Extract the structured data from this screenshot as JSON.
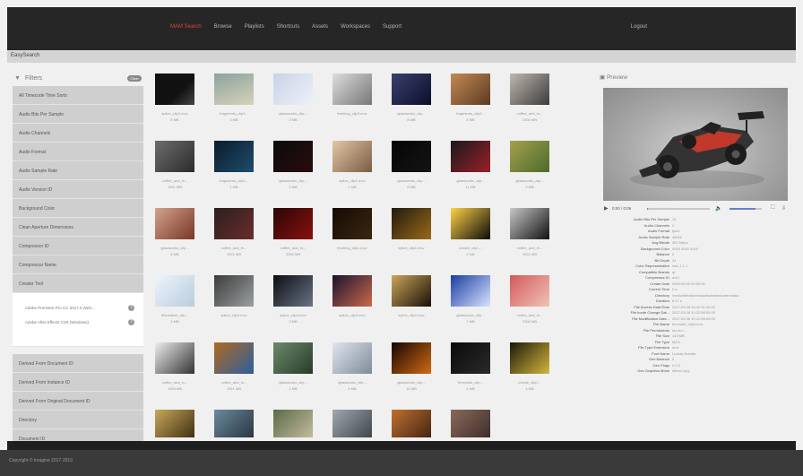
{
  "nav": {
    "items": [
      {
        "label": "MAM Search",
        "active": true
      },
      {
        "label": "Browse",
        "active": false
      },
      {
        "label": "Playlists",
        "active": false
      },
      {
        "label": "Shortcuts",
        "active": false
      },
      {
        "label": "Assets",
        "active": false
      },
      {
        "label": "Workspaces",
        "active": false
      },
      {
        "label": "Support",
        "active": false
      }
    ],
    "login_label": "Logout"
  },
  "subbar": {
    "title": "EasySearch"
  },
  "filters": {
    "title": "Filters",
    "clear_label": "Clear",
    "items": [
      "All Timecode Time Sorts",
      "Audio Bits Per Sample",
      "Audio Channels",
      "Audio Format",
      "Audio Sample Rate",
      "Audio Version ID",
      "Background Color",
      "Clean Aperture Dimensions",
      "Compressor ID",
      "Compressor Name",
      "Creator Tool"
    ],
    "creator_tool_options": [
      {
        "label": "Adobe Premiere Pro CC 2017.0 (Win...",
        "icon": "help-icon"
      },
      {
        "label": "Adobe After Effects CS6 (Windows)",
        "icon": "help-icon"
      }
    ],
    "items_after": [
      "Derived From Document ID",
      "Derived From Instance ID",
      "Derived From Original Document ID",
      "Directory",
      "Document ID"
    ]
  },
  "assets": [
    {
      "name": "splice_clip2.mov",
      "size": "6 MB"
    },
    {
      "name": "fragments_clip2...",
      "size": "3 MB"
    },
    {
      "name": "glassworks_clip...",
      "size": "2 MB"
    },
    {
      "name": "freshing_clip3.mov",
      "size": ""
    },
    {
      "name": "glassworks_clip...",
      "size": "8 MB"
    },
    {
      "name": "fragments_clip2...",
      "size": "4 MB"
    },
    {
      "name": "coffee_and_ln...",
      "size": "2300 MB"
    },
    {
      "name": "coffee_and_ln...",
      "size": "1921 MB"
    },
    {
      "name": "fragments_clip3...",
      "size": "1 MB"
    },
    {
      "name": "glassworks_clip...",
      "size": "3 MB"
    },
    {
      "name": "splice_clip1.mov",
      "size": "1 MB"
    },
    {
      "name": "glassworks_clip...",
      "size": "8 MB"
    },
    {
      "name": "glassworks_clip...",
      "size": "11 MB"
    },
    {
      "name": "glassworks_clip...",
      "size": "5 MB"
    },
    {
      "name": "glassworks_clip...",
      "size": "6 MB"
    },
    {
      "name": "coffee_and_ln...",
      "size": "1921 MB"
    },
    {
      "name": "coffee_and_ln...",
      "size": "2300 MB"
    },
    {
      "name": "freshing_clip1.mov",
      "size": ""
    },
    {
      "name": "splice_clip1.mov",
      "size": ""
    },
    {
      "name": "chaste_clip1...",
      "size": "2 MB"
    },
    {
      "name": "coffee_and_ln...",
      "size": "1921 MB"
    },
    {
      "name": "thermalise_clip...",
      "size": "3 MB"
    },
    {
      "name": "splice_clip4.mov",
      "size": ""
    },
    {
      "name": "splice_clip4.mov",
      "size": "3 MB"
    },
    {
      "name": "splice_clip3.mov",
      "size": ""
    },
    {
      "name": "splice_clip2.mov",
      "size": ""
    },
    {
      "name": "glassworks_clip...",
      "size": "7 MB"
    },
    {
      "name": "coffee_and_ln...",
      "size": "2300 MB"
    },
    {
      "name": "coffee_and_ln...",
      "size": "1926 MB"
    },
    {
      "name": "coffee_and_ln...",
      "size": "1921 MB"
    },
    {
      "name": "glassworks_clip...",
      "size": "1 MB"
    },
    {
      "name": "glassworks_clip...",
      "size": "6 MB"
    },
    {
      "name": "glassworks_clip...",
      "size": "10 MB"
    },
    {
      "name": "fireworks_clip...",
      "size": "4 MB"
    },
    {
      "name": "chaste_clip2...",
      "size": "4 MB"
    },
    {
      "name": "",
      "size": ""
    },
    {
      "name": "",
      "size": ""
    },
    {
      "name": "",
      "size": ""
    },
    {
      "name": "",
      "size": ""
    },
    {
      "name": "",
      "size": ""
    },
    {
      "name": "",
      "size": ""
    }
  ],
  "preview": {
    "title": "Preview",
    "time": "0:00 / 0:06",
    "playback_progress": 0.02,
    "volume_level": 0.8,
    "metadata": [
      {
        "key": "Audio Bits Per Sample",
        "value": "16"
      },
      {
        "key": "Audio Channels",
        "value": "2"
      },
      {
        "key": "Audio Format",
        "value": "lpcm"
      },
      {
        "key": "Audio Sample Rate",
        "value": "48000"
      },
      {
        "key": "Avg Bitrate",
        "value": "352 Mbps"
      },
      {
        "key": "Background Color",
        "value": "0000 0000 0000"
      },
      {
        "key": "Balance",
        "value": "0"
      },
      {
        "key": "Bit Depth",
        "value": "24"
      },
      {
        "key": "Color Representation",
        "value": "nclc 1 1 1"
      },
      {
        "key": "Compatible Brands",
        "value": "qt"
      },
      {
        "key": "Compressor ID",
        "value": "avc1"
      },
      {
        "key": "Create Date",
        "value": "0000:00:00 00:00:00"
      },
      {
        "key": "Current Time",
        "value": "0 s"
      },
      {
        "key": "Directory",
        "value": "/mnt/unifiedstore/assets/teamshare/media"
      },
      {
        "key": "Duration",
        "value": "6.17 s"
      },
      {
        "key": "File Access Date/Time",
        "value": "2017:03:28 10:42:31-05:00"
      },
      {
        "key": "File Inode Change Dat...",
        "value": "2017:03:28 10:22:58-05:00"
      },
      {
        "key": "File Modification Date...",
        "value": "2017:03:28 10:22:58-05:00"
      },
      {
        "key": "File Name",
        "value": "formulae_clip6.mov"
      },
      {
        "key": "File Permissions",
        "value": "rw-rw-r--"
      },
      {
        "key": "File Size",
        "value": "143 MB"
      },
      {
        "key": "File Type",
        "value": "MOV"
      },
      {
        "key": "File Type Extension",
        "value": "mov"
      },
      {
        "key": "Font Name",
        "value": "Lucida Grande"
      },
      {
        "key": "Gen Balance",
        "value": "0"
      },
      {
        "key": "Gen Flags",
        "value": "0 0 0"
      },
      {
        "key": "Gen Graphics Mode",
        "value": "ditherCopy"
      }
    ]
  },
  "footer": {
    "text": "Copyright © Imagine 2017-2019"
  },
  "colors": {
    "accent": "#d9463a",
    "topbar": "#262626",
    "footer": "#3a3a3a"
  }
}
